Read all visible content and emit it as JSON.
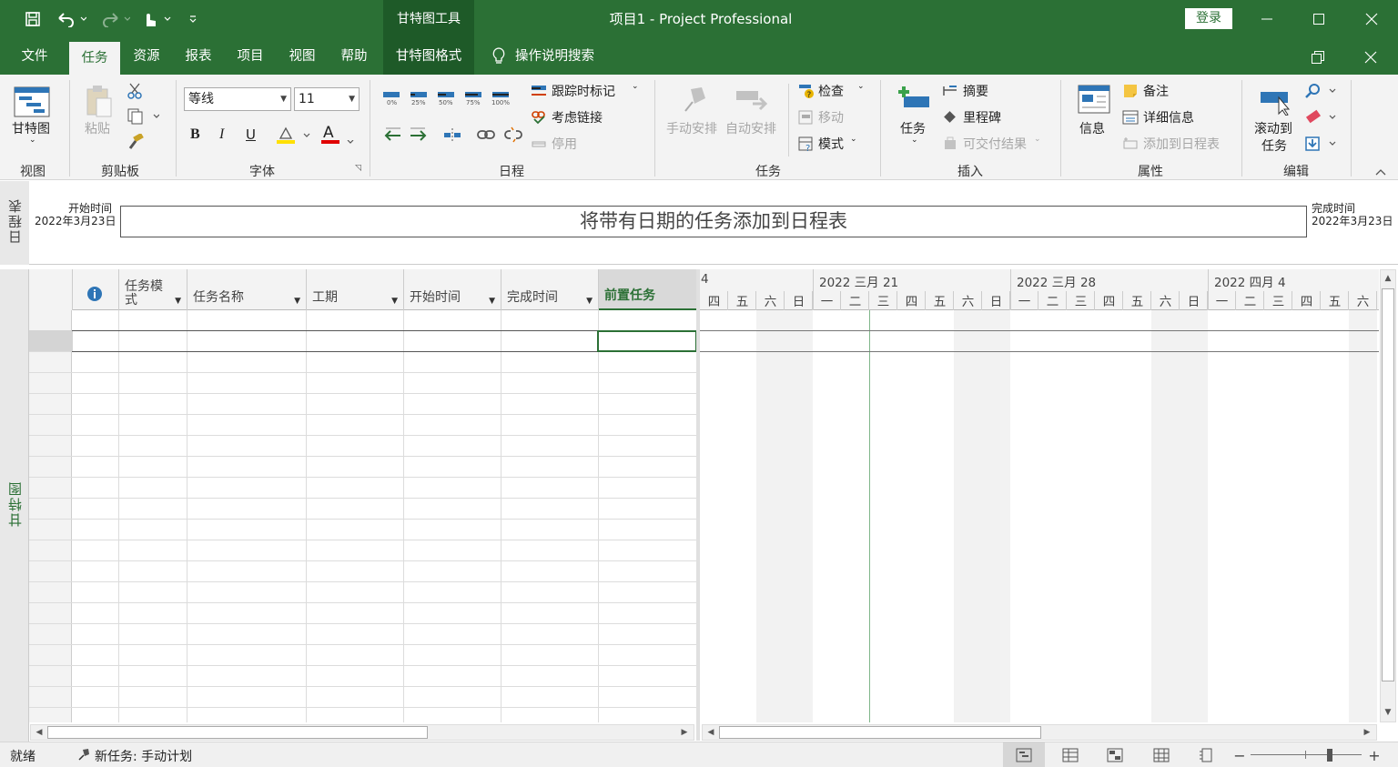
{
  "titlebar": {
    "contextual_tab": "甘特图工具",
    "title": "项目1  -  Project Professional",
    "login": "登录"
  },
  "menu": {
    "file": "文件",
    "task": "任务",
    "resource": "资源",
    "report": "报表",
    "project": "项目",
    "view": "视图",
    "help": "帮助",
    "gantt_format": "甘特图格式",
    "search": "操作说明搜索"
  },
  "ribbon": {
    "view": {
      "gantt": "甘特图",
      "label": "视图"
    },
    "clipboard": {
      "paste": "粘贴",
      "label": "剪贴板"
    },
    "font": {
      "name": "等线",
      "size": "11",
      "bold": "B",
      "italic": "I",
      "underline": "U",
      "color_letter": "A",
      "label": "字体"
    },
    "schedule": {
      "pct": [
        "0%",
        "25%",
        "50%",
        "75%",
        "100%"
      ],
      "mark_on_track": "跟踪时标记",
      "respect_links": "考虑链接",
      "inactivate": "停用",
      "label": "日程"
    },
    "tasks": {
      "manual": "手动安排",
      "auto": "自动安排",
      "inspect": "检查",
      "move": "移动",
      "mode": "模式",
      "label": "任务"
    },
    "insert": {
      "task": "任务",
      "summary": "摘要",
      "milestone": "里程碑",
      "deliverable": "可交付结果",
      "label": "插入"
    },
    "properties": {
      "info": "信息",
      "notes": "备注",
      "details": "详细信息",
      "add_timeline": "添加到日程表",
      "label": "属性"
    },
    "editing": {
      "scroll_to_task_1": "滚动到",
      "scroll_to_task_2": "任务",
      "label": "编辑"
    }
  },
  "timeline": {
    "side_label": "日程表",
    "start_label": "开始时间",
    "start_date": "2022年3月23日",
    "end_label": "完成时间",
    "end_date": "2022年3月23日",
    "placeholder": "将带有日期的任务添加到日程表"
  },
  "gantt": {
    "side_label": "甘特图",
    "columns": [
      "任务模式",
      "任务名称",
      "工期",
      "开始时间",
      "完成时间",
      "前置任务"
    ],
    "col_mode_l1": "任务模",
    "col_mode_l2": "式"
  },
  "chart": {
    "weeks": [
      "4",
      "2022 三月 21",
      "2022 三月 28",
      "2022 四月 4"
    ],
    "days": [
      "四",
      "五",
      "六",
      "日",
      "一",
      "二",
      "三",
      "四",
      "五",
      "六",
      "日",
      "一",
      "二",
      "三",
      "四",
      "五",
      "六",
      "日",
      "一",
      "二",
      "三",
      "四",
      "五",
      "六"
    ]
  },
  "status": {
    "ready": "就绪",
    "new_tasks": "新任务: 手动计划"
  },
  "colors": {
    "accent": "#2b7035",
    "ribbon_bg": "#f3f3f3"
  }
}
